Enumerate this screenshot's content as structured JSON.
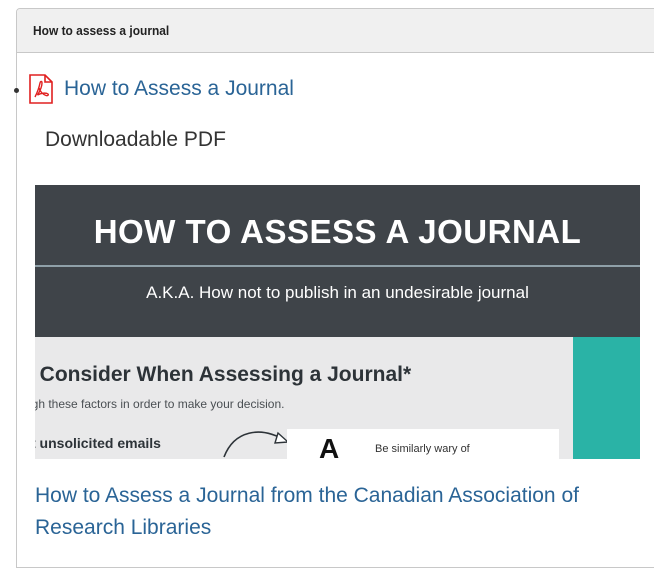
{
  "panel": {
    "title": "How to assess a journal"
  },
  "resource": {
    "icon": "pdf-icon",
    "link_label": "How to Assess a Journal",
    "description": "Downloadable PDF"
  },
  "preview": {
    "title": "HOW TO ASSESS A JOURNAL",
    "subtitle": "A.K.A. How not to publish in an undesirable journal",
    "heading": "o Consider When Assessing a Journal*",
    "instruction": "igh these factors in order to make your decision.",
    "item": "t unsolicited emails",
    "card_letter": "A",
    "card_text": "Be similarly wary of"
  },
  "caption": "How to Assess a Journal from the Canadian Association of Research Libraries",
  "colors": {
    "link": "#2a6496",
    "banner": "#3f4449",
    "teal": "#2ab3a6",
    "pdf_red": "#e02020"
  }
}
